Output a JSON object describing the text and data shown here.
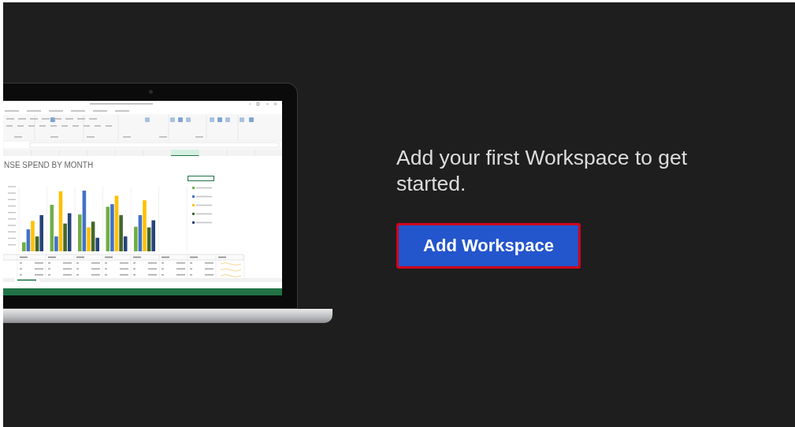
{
  "laptop_screen": {
    "sheet_title": "NSE SPEND BY MONTH"
  },
  "message": "Add your first Workspace to get started.",
  "add_button": {
    "label": "Add Workspace",
    "highlighted": true
  }
}
